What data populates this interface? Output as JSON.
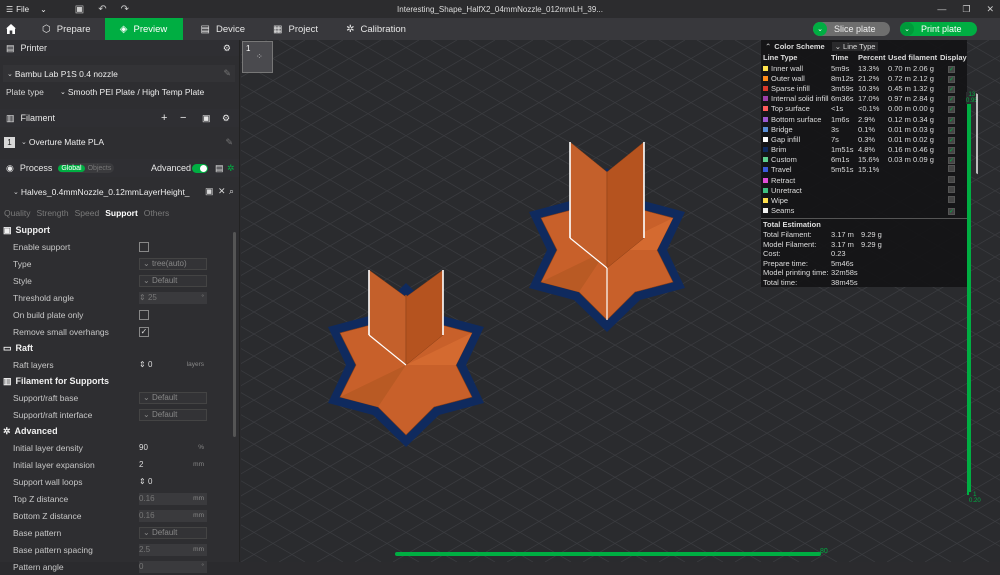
{
  "titlebar": {
    "menu_label": "File",
    "title": "Interesting_Shape_HalfX2_04mmNozzle_012mmLH_39..."
  },
  "nav": {
    "tabs": [
      {
        "label": "Prepare"
      },
      {
        "label": "Preview"
      },
      {
        "label": "Device"
      },
      {
        "label": "Project"
      },
      {
        "label": "Calibration"
      }
    ],
    "slice_label": "Slice plate",
    "print_label": "Print plate"
  },
  "printer": {
    "section_title": "Printer",
    "name": "Bambu Lab P1S 0.4 nozzle",
    "plate_type_label": "Plate type",
    "plate_type_value": "Smooth PEI Plate / High Temp Plate"
  },
  "filament": {
    "section_title": "Filament",
    "index": "1",
    "name": "Overture Matte PLA"
  },
  "process": {
    "section_title": "Process",
    "global_label": "Global",
    "objects_label": "Objects",
    "advanced_label": "Advanced",
    "profile": "Halves_0.4mmNozzle_0.12mmLayerHeight_",
    "tabs": [
      "Quality",
      "Strength",
      "Speed",
      "Support",
      "Others"
    ],
    "active_tab": "Support"
  },
  "settings": {
    "support_group": "Support",
    "enable_support": "Enable support",
    "type_label": "Type",
    "type_value": "tree(auto)",
    "style_label": "Style",
    "style_value": "Default",
    "threshold_label": "Threshold angle",
    "threshold_value": "25",
    "threshold_unit": "°",
    "build_plate_only": "On build plate only",
    "remove_small": "Remove small overhangs",
    "raft_group": "Raft",
    "raft_layers_label": "Raft layers",
    "raft_layers_value": "0",
    "raft_layers_unit": "layers",
    "filament_group": "Filament for Supports",
    "raft_base_label": "Support/raft base",
    "raft_base_value": "Default",
    "raft_interface_label": "Support/raft interface",
    "raft_interface_value": "Default",
    "advanced_group": "Advanced",
    "init_density_label": "Initial layer density",
    "init_density_value": "90",
    "init_density_unit": "%",
    "init_expansion_label": "Initial layer expansion",
    "init_expansion_value": "2",
    "init_expansion_unit": "mm",
    "wall_loops_label": "Support wall loops",
    "wall_loops_value": "0",
    "top_z_label": "Top Z distance",
    "top_z_value": "0.16",
    "top_z_unit": "mm",
    "bottom_z_label": "Bottom Z distance",
    "bottom_z_value": "0.16",
    "bottom_z_unit": "mm",
    "base_pattern_label": "Base pattern",
    "base_pattern_value": "Default",
    "base_spacing_label": "Base pattern spacing",
    "base_spacing_value": "2.5",
    "base_spacing_unit": "mm",
    "pattern_angle_label": "Pattern angle",
    "pattern_angle_value": "0",
    "pattern_angle_unit": "°"
  },
  "viewport": {
    "plate_number": "1",
    "slider_top": "13",
    "slider_top_sub": "0.95",
    "slider_bottom": "1",
    "slider_bottom_sub": "0.20",
    "h_slider_value": "80"
  },
  "legend": {
    "color_scheme_label": "Color Scheme",
    "color_scheme_value": "Line Type",
    "headers": [
      "Line Type",
      "Time",
      "Percent",
      "Used filament",
      "Display"
    ],
    "rows": [
      {
        "name": "Inner wall",
        "color": "#ffe34d",
        "time": "5m9s",
        "percent": "13.3%",
        "used": "0.70 m 2.06 g",
        "display": true
      },
      {
        "name": "Outer wall",
        "color": "#ff8c1a",
        "time": "8m12s",
        "percent": "21.2%",
        "used": "0.72 m 2.12 g",
        "display": true
      },
      {
        "name": "Sparse infill",
        "color": "#d93a2b",
        "time": "3m59s",
        "percent": "10.3%",
        "used": "0.45 m 1.32 g",
        "display": true
      },
      {
        "name": "Internal solid infill",
        "color": "#9c3fa8",
        "time": "6m36s",
        "percent": "17.0%",
        "used": "0.97 m 2.84 g",
        "display": true
      },
      {
        "name": "Top surface",
        "color": "#ff5c5c",
        "time": "<1s",
        "percent": "<0.1%",
        "used": "0.00 m 0.00 g",
        "display": true
      },
      {
        "name": "Bottom surface",
        "color": "#9b59d0",
        "time": "1m6s",
        "percent": "2.9%",
        "used": "0.12 m 0.34 g",
        "display": true
      },
      {
        "name": "Bridge",
        "color": "#5a8fd6",
        "time": "3s",
        "percent": "0.1%",
        "used": "0.01 m 0.03 g",
        "display": true
      },
      {
        "name": "Gap infill",
        "color": "#ffffff",
        "time": "7s",
        "percent": "0.3%",
        "used": "0.01 m 0.02 g",
        "display": true
      },
      {
        "name": "Brim",
        "color": "#0f2a5e",
        "time": "1m51s",
        "percent": "4.8%",
        "used": "0.16 m 0.46 g",
        "display": true
      },
      {
        "name": "Custom",
        "color": "#5fcf8f",
        "time": "6m1s",
        "percent": "15.6%",
        "used": "0.03 m 0.09 g",
        "display": true
      },
      {
        "name": "Travel",
        "color": "#3b5bdb",
        "time": "5m51s",
        "percent": "15.1%",
        "used": "",
        "display": false
      },
      {
        "name": "Retract",
        "color": "#e24dd6",
        "time": "",
        "percent": "",
        "used": "",
        "display": false
      },
      {
        "name": "Unretract",
        "color": "#3fbf7f",
        "time": "",
        "percent": "",
        "used": "",
        "display": false
      },
      {
        "name": "Wipe",
        "color": "#ffe04d",
        "time": "",
        "percent": "",
        "used": "",
        "display": false
      },
      {
        "name": "Seams",
        "color": "#f2f2f2",
        "time": "",
        "percent": "",
        "used": "",
        "display": true
      }
    ],
    "total_label": "Total Estimation",
    "totals": [
      {
        "label": "Total Filament:",
        "a": "3.17 m",
        "b": "9.29 g"
      },
      {
        "label": "Model Filament:",
        "a": "3.17 m",
        "b": "9.29 g"
      },
      {
        "label": "Cost:",
        "a": "0.23",
        "b": ""
      },
      {
        "label": "Prepare time:",
        "a": "5m46s",
        "b": ""
      },
      {
        "label": "Model printing time:",
        "a": "32m58s",
        "b": ""
      },
      {
        "label": "Total time:",
        "a": "38m45s",
        "b": ""
      }
    ]
  },
  "colors": {
    "accent": "#00ae42",
    "model": "#c8602a",
    "brim": "#0f2a5e"
  }
}
